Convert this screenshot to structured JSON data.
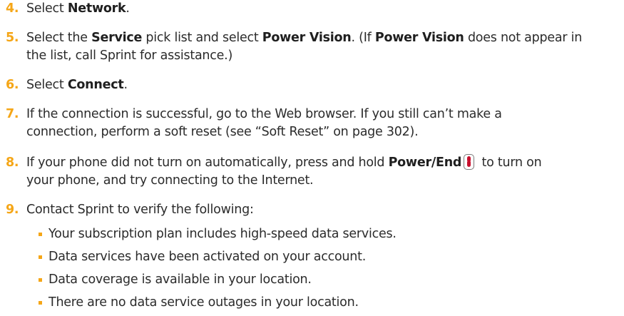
{
  "colors": {
    "accent": "#f5a617",
    "text": "#2b2b2b",
    "key_red": "#c8102e"
  },
  "steps": [
    {
      "num": "4.",
      "parts": [
        "Select ",
        "Network",
        "."
      ]
    },
    {
      "num": "5.",
      "parts": [
        "Select the ",
        "Service",
        " pick list and select ",
        "Power Vision",
        ". (If ",
        "Power Vision",
        " does not appear in",
        "the list, call Sprint for assistance.)"
      ]
    },
    {
      "num": "6.",
      "parts": [
        "Select ",
        "Connect",
        "."
      ]
    },
    {
      "num": "7.",
      "parts": [
        "If the connection is successful, go to the Web browser. If you still can’t make a",
        "connection, perform a soft reset (see “Soft Reset” on page 302)."
      ]
    },
    {
      "num": "8.",
      "parts": [
        "If your phone did not turn on automatically, press and hold ",
        "Power/End",
        " to turn on",
        "your phone, and try connecting to the Internet."
      ],
      "icon": "power-end-key-icon"
    },
    {
      "num": "9.",
      "parts": [
        "Contact Sprint to verify the following:"
      ]
    }
  ],
  "bullets": [
    "Your subscription plan includes high-speed data services.",
    "Data services have been activated on your account.",
    "Data coverage is available in your location.",
    "There are no data service outages in your location."
  ]
}
